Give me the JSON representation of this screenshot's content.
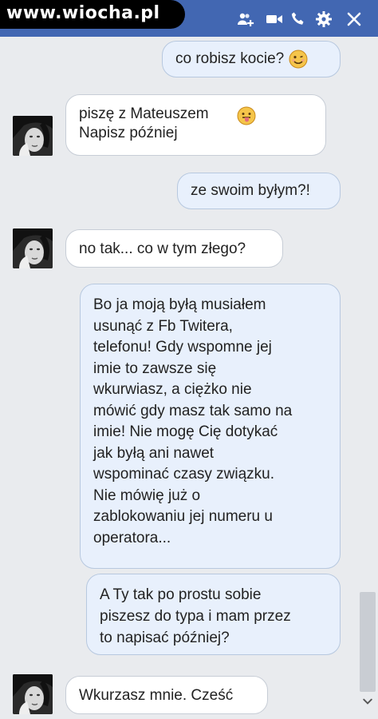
{
  "watermark": {
    "text": "www.wiocha.pl"
  },
  "header": {
    "icons": [
      "add-people-icon",
      "video-call-icon",
      "phone-icon",
      "gear-icon",
      "close-icon"
    ]
  },
  "messages": [
    {
      "direction": "out",
      "text": "co robisz kocie?",
      "emoji": "grin-emoji"
    },
    {
      "direction": "in",
      "text": "piszę z Mateuszem\nNapisz później",
      "emoji": "tongue-emoji"
    },
    {
      "direction": "out",
      "text": "ze swoim byłym?!"
    },
    {
      "direction": "in",
      "text": "no tak... co w tym złego?"
    },
    {
      "direction": "out",
      "text": "Bo ja moją byłą musiałem\nusunąć z Fb Twitera,\ntelefonu! Gdy wspomne jej\nimie to zawsze się\nwkurwiasz, a ciężko nie\nmówić gdy masz tak samo na\nimie! Nie mogę Cię dotykać\njak byłą ani nawet\nwspominać czasy związku.\nNie mówię już o\nzablokowaniu jej numeru u\noperatora..."
    },
    {
      "direction": "out",
      "text": "A Ty tak po prostu sobie\npiszesz do typa i mam przez\nto napisać później?"
    },
    {
      "direction": "in",
      "text": "Wkurzasz mnie. Cześć"
    }
  ],
  "colors": {
    "header": "#4267b2",
    "outgoing_bubble": "#e8f0fc",
    "incoming_bubble": "#ffffff",
    "background": "#e9ebee"
  }
}
